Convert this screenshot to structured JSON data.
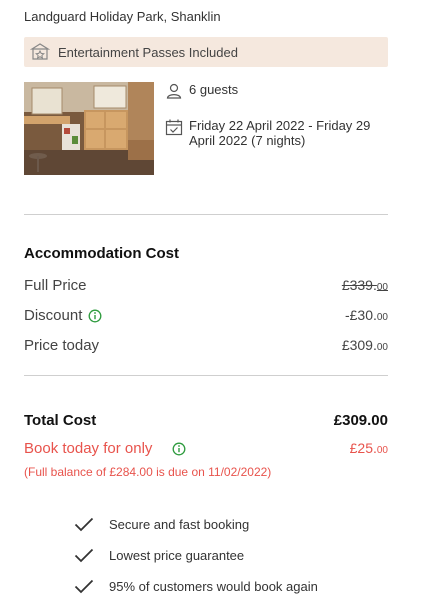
{
  "location": "Landguard Holiday Park, Shanklin",
  "entertainment": {
    "label": "Entertainment Passes Included",
    "icon": "ticket-star-icon"
  },
  "photo": {
    "alt": "Caravan kitchen interior",
    "icon": "photo"
  },
  "guests": {
    "icon": "person-icon",
    "text": "6 guests"
  },
  "dates": {
    "icon": "calendar-check-icon",
    "text": "Friday 22 April 2022 - Friday 29 April 2022 (7 nights)"
  },
  "accommodation": {
    "title": "Accommodation Cost",
    "full_price": {
      "label": "Full Price",
      "main": "£339.",
      "dec": "00"
    },
    "discount": {
      "label": "Discount",
      "main": "-£30.",
      "dec": "00"
    },
    "price_today": {
      "label": "Price today",
      "main": "£309.",
      "dec": "00"
    }
  },
  "total": {
    "label": "Total Cost",
    "value": "£309.00"
  },
  "book_today": {
    "label": "Book today for only",
    "main": "£25.",
    "dec": "00"
  },
  "balance_note": "(Full balance of £284.00 is due on 11/02/2022)",
  "features": [
    {
      "icon": "check-icon",
      "text": "Secure and fast booking"
    },
    {
      "icon": "check-icon",
      "text": "Lowest price guarantee"
    },
    {
      "icon": "check-icon",
      "text": "95% of customers would book again"
    }
  ],
  "colors": {
    "accent_red": "#e8534c",
    "info_green": "#2e9b3e",
    "banner_bg": "#f5e8de"
  }
}
